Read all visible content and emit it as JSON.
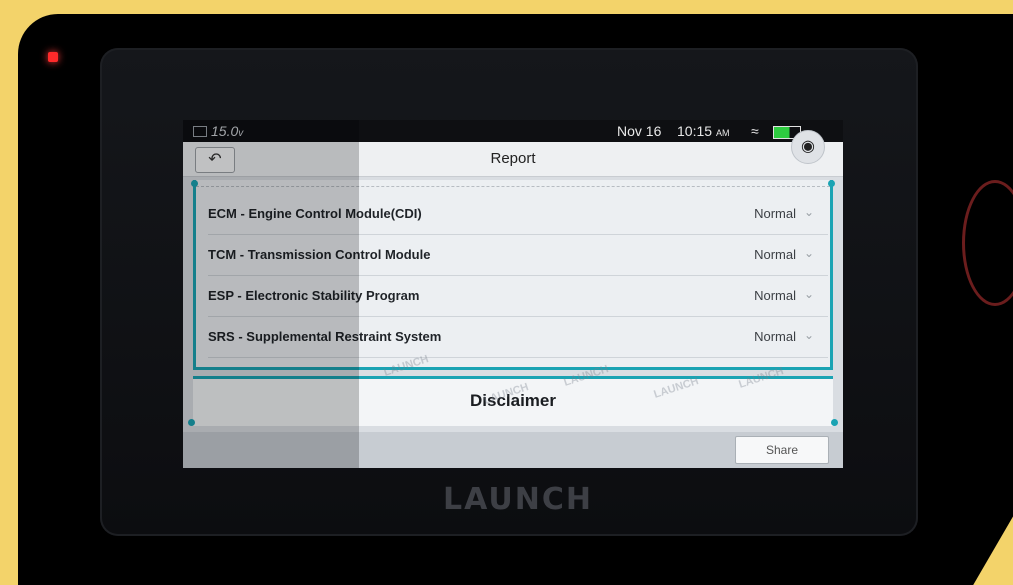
{
  "status_bar": {
    "voltage": "15.0",
    "voltage_unit": "v",
    "date": "Nov 16",
    "time": "10:15",
    "ampm": "AM"
  },
  "header": {
    "title": "Report",
    "back_icon": "back-arrow-icon"
  },
  "modules": [
    {
      "name": "ECM - Engine Control Module(CDI)",
      "status": "Normal"
    },
    {
      "name": "TCM - Transmission Control Module",
      "status": "Normal"
    },
    {
      "name": "ESP - Electronic Stability Program",
      "status": "Normal"
    },
    {
      "name": "SRS - Supplemental Restraint System",
      "status": "Normal"
    }
  ],
  "disclaimer": {
    "title": "Disclaimer"
  },
  "footer": {
    "share_label": "Share"
  },
  "device": {
    "brand": "LAUNCH"
  },
  "colors": {
    "accent": "#1aa3b3",
    "frame": "#f3d36a"
  },
  "watermark_text": "LAUNCH"
}
